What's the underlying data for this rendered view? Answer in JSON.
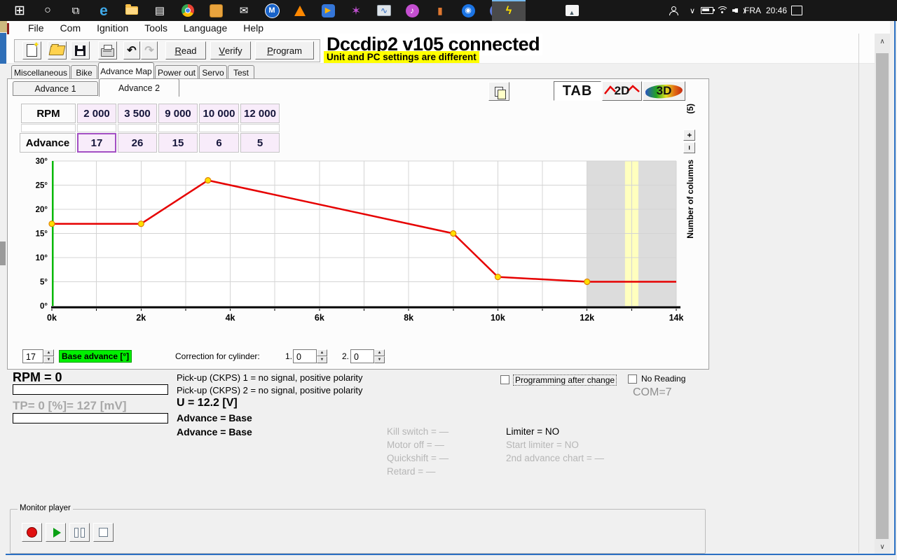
{
  "taskbar": {
    "language": "FRA",
    "time": "20:46",
    "app_icons": [
      {
        "name": "start-icon",
        "glyph": "⊞",
        "fg": "#ffffff",
        "fs": 19
      },
      {
        "name": "search-icon",
        "glyph": "○",
        "fg": "#ffffff",
        "fs": 16
      },
      {
        "name": "task-view-icon",
        "glyph": "⧉",
        "fg": "#ffffff",
        "fs": 15
      },
      {
        "name": "edge-icon",
        "glyph": "e",
        "fg": "#3fa9e8",
        "fs": 21,
        "bold": true
      },
      {
        "name": "file-explorer-icon",
        "cls": "i-folder"
      },
      {
        "name": "store-icon",
        "glyph": "▤",
        "fg": "#ffffff",
        "fs": 15
      },
      {
        "name": "chrome-icon",
        "cls": "i-chrome"
      },
      {
        "name": "sticky-notes-icon",
        "cls": "i-notes"
      },
      {
        "name": "mail-icon",
        "glyph": "✉",
        "fg": "#ffffff",
        "fs": 15
      },
      {
        "name": "m-app-icon",
        "glyph": "M",
        "fg": "#ffffff",
        "fs": 11,
        "bold": true,
        "bg": "#1862c8",
        "round": true,
        "ring": true
      },
      {
        "name": "vlc-icon",
        "cls": "i-cone"
      },
      {
        "name": "media-player-icon",
        "glyph": "▶",
        "fg": "#ffb300",
        "fs": 11,
        "bg": "#3576d8"
      },
      {
        "name": "graphics-tool-icon",
        "glyph": "✶",
        "fg": "#c050d0",
        "fs": 17
      },
      {
        "name": "system-monitor-icon",
        "glyph": "∿",
        "fg": "#2060c0",
        "fs": 12,
        "cls": "i-mon"
      },
      {
        "name": "itunes-icon",
        "glyph": "♪",
        "fg": "#ffffff",
        "fs": 12,
        "bg": "#c44fd0",
        "round": true
      },
      {
        "name": "mobile-device-icon",
        "glyph": "▮",
        "fg": "#e07830",
        "fs": 14
      },
      {
        "name": "messenger-icon",
        "glyph": "◉",
        "fg": "#ffffff",
        "fs": 11,
        "bg": "#1b74e4",
        "round": true
      },
      {
        "name": "skype-icon",
        "glyph": "S",
        "fg": "#ffffff",
        "fs": 13,
        "bold": true,
        "bg": "#5b78d6",
        "round": true
      },
      {
        "name": "ignition-app-icon",
        "glyph": "ϟ",
        "fg": "#ffe000",
        "fs": 16,
        "bold": true,
        "active": true
      },
      {
        "name": "photos-icon",
        "glyph": "▲",
        "fg": "#455a64",
        "fs": 9,
        "cls": "i-photos"
      }
    ]
  },
  "icons": {
    "undo": "↶",
    "redo": "↷",
    "tray_chevron": "∨",
    "scroll_up": "∧",
    "scroll_down": "∨",
    "new_sparkle": "✦",
    "spin_up": "▲",
    "spin_down": "▼",
    "column_plus": "+",
    "column_minus": "−",
    "play": "▶"
  },
  "menu": {
    "items": [
      "File",
      "Com",
      "Ignition",
      "Tools",
      "Language",
      "Help"
    ]
  },
  "toolbar": {
    "read_label": "Read",
    "verify_label": "Verify",
    "program_label": "Program"
  },
  "header": {
    "title": "Dccdip2 v105 connected",
    "warning": "Unit and PC settings are different"
  },
  "tabs": {
    "items": [
      "Miscellaneous",
      "Bike",
      "Advance Map",
      "Power out",
      "Servo",
      "Test"
    ],
    "active": "Advance Map"
  },
  "subtabs": {
    "items": [
      "Advance 1",
      "Advance 2"
    ],
    "active": "Advance 2"
  },
  "view_controls": {
    "tab_label": "TAB",
    "two_d_label": "2D",
    "three_d_label": "3D"
  },
  "map_table": {
    "rpm_label": "RPM",
    "advance_label": "Advance",
    "rpm_values": [
      "2 000",
      "3 500",
      "9 000",
      "10 000",
      "12 000"
    ],
    "advance_values": [
      "17",
      "26",
      "15",
      "6",
      "5"
    ],
    "selected_column": 1
  },
  "columns_control": {
    "count": "(5)",
    "label": "Number of columns"
  },
  "chart_data": {
    "type": "line",
    "x": [
      0,
      2000,
      3500,
      9000,
      10000,
      12000,
      14000
    ],
    "y": [
      17,
      17,
      26,
      15,
      6,
      5,
      5
    ],
    "marker_count": 6,
    "xlim": [
      0,
      14000
    ],
    "ylim": [
      0,
      30
    ],
    "x_gridline_step": 1000,
    "y_gridline_step": 5,
    "x_tick_step": 2000,
    "x_tick_labels": [
      "0k",
      "2k",
      "4k",
      "6k",
      "8k",
      "10k",
      "12k",
      "14k"
    ],
    "y_tick_labels": [
      "0°",
      "5°",
      "10°",
      "15°",
      "20°",
      "25°",
      "30°"
    ],
    "disabled_region": [
      12000,
      14000
    ],
    "highlight_band": [
      12850,
      13150
    ],
    "line_color": "#e60000",
    "marker_fill": "#ffe000",
    "marker_stroke": "#e08000",
    "grid_color": "#d4d4d4",
    "y_axis_color": "#00b800",
    "x_axis_color": "#000000",
    "disabled_color": "#dcdcdc",
    "band_color": "#ffffbe"
  },
  "bottom_controls": {
    "base_advance_value": "17",
    "base_advance_label": "Base advance [°]",
    "base_advance_bg": "#00f000",
    "correction_label": "Correction for cylinder:",
    "cyl1_label": "1.",
    "cyl1_value": "0",
    "cyl2_label": "2.",
    "cyl2_value": "0"
  },
  "status": {
    "rpm": "RPM = 0",
    "tp": "TP= 0 [%]= 127 [mV]",
    "pickup1": "Pick-up (CKPS) 1 = no signal, positive polarity",
    "pickup2": "Pick-up (CKPS) 2 = no signal, positive polarity",
    "voltage": "U = 12.2 [V]",
    "advance1": "Advance = Base",
    "advance2": "Advance = Base",
    "kill_switch": "Kill switch = —",
    "motor_off": "Motor off = —",
    "quickshift": "Quickshift = —",
    "retard": "Retard = —",
    "limiter": "Limiter = NO",
    "start_limiter": "Start limiter = NO",
    "second_chart": "2nd advance chart = —",
    "programming_checkbox": "Programming after change",
    "no_reading_checkbox": "No Reading",
    "com": "COM=7"
  },
  "monitor_player": {
    "legend": "Monitor player"
  }
}
